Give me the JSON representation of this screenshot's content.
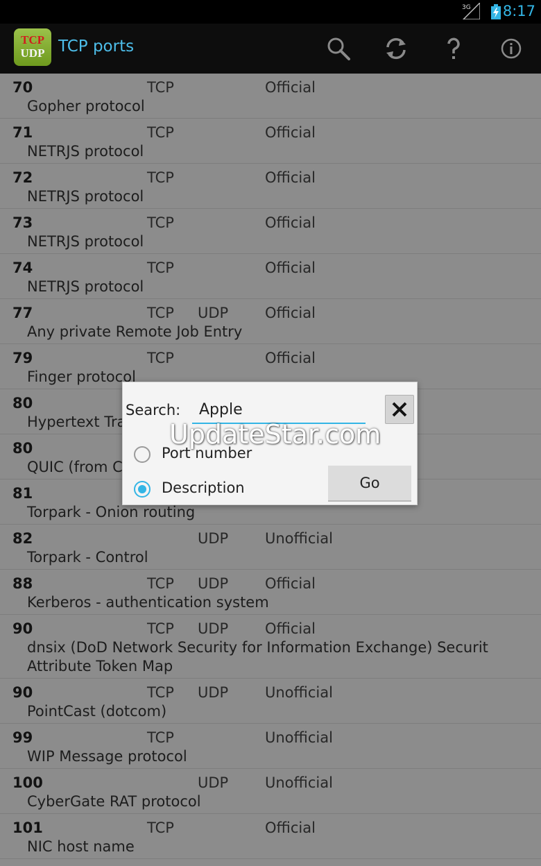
{
  "status_bar": {
    "network": "3G",
    "time": "8:17",
    "time_color": "#33b5e5"
  },
  "action_bar": {
    "logo_line1": "TCP",
    "logo_line2": "UDP",
    "title": "TCP ports",
    "title_color": "#4dbde9",
    "icons": [
      "search-icon",
      "refresh-icon",
      "help-icon",
      "info-icon"
    ]
  },
  "ports": [
    {
      "port": "70",
      "tcp": "TCP",
      "udp": "",
      "status": "Official",
      "desc": "Gopher protocol"
    },
    {
      "port": "71",
      "tcp": "TCP",
      "udp": "",
      "status": "Official",
      "desc": "NETRJS protocol"
    },
    {
      "port": "72",
      "tcp": "TCP",
      "udp": "",
      "status": "Official",
      "desc": "NETRJS protocol"
    },
    {
      "port": "73",
      "tcp": "TCP",
      "udp": "",
      "status": "Official",
      "desc": "NETRJS protocol"
    },
    {
      "port": "74",
      "tcp": "TCP",
      "udp": "",
      "status": "Official",
      "desc": "NETRJS protocol"
    },
    {
      "port": "77",
      "tcp": "TCP",
      "udp": "UDP",
      "status": "Official",
      "desc": "Any private Remote Job Entry"
    },
    {
      "port": "79",
      "tcp": "TCP",
      "udp": "",
      "status": "Official",
      "desc": "Finger protocol"
    },
    {
      "port": "80",
      "tcp": "",
      "udp": "",
      "status": "",
      "desc": "Hypertext Tra"
    },
    {
      "port": "80",
      "tcp": "",
      "udp": "",
      "status": "",
      "desc": "QUIC (from C"
    },
    {
      "port": "81",
      "tcp": "",
      "udp": "",
      "status": "",
      "desc": "Torpark - Onion routing"
    },
    {
      "port": "82",
      "tcp": "",
      "udp": "UDP",
      "status": "Unofficial",
      "desc": "Torpark - Control"
    },
    {
      "port": "88",
      "tcp": "TCP",
      "udp": "UDP",
      "status": "Official",
      "desc": "Kerberos - authentication system"
    },
    {
      "port": "90",
      "tcp": "TCP",
      "udp": "UDP",
      "status": "Official",
      "desc": "dnsix (DoD Network Security for Information Exchange) Securit Attribute Token Map"
    },
    {
      "port": "90",
      "tcp": "TCP",
      "udp": "UDP",
      "status": "Unofficial",
      "desc": "PointCast (dotcom)"
    },
    {
      "port": "99",
      "tcp": "TCP",
      "udp": "",
      "status": "Unofficial",
      "desc": "WIP Message protocol"
    },
    {
      "port": "100",
      "tcp": "",
      "udp": "UDP",
      "status": "Unofficial",
      "desc": "CyberGate RAT protocol"
    },
    {
      "port": "101",
      "tcp": "TCP",
      "udp": "",
      "status": "Official",
      "desc": "NIC host name"
    }
  ],
  "dialog": {
    "search_label": "Search:",
    "search_value": "Apple",
    "close_icon": "close-icon",
    "option_port": "Port number",
    "option_desc": "Description",
    "selected": "Description",
    "go_label": "Go",
    "accent_color": "#33b5e5"
  },
  "watermark": "UpdateStar.com"
}
